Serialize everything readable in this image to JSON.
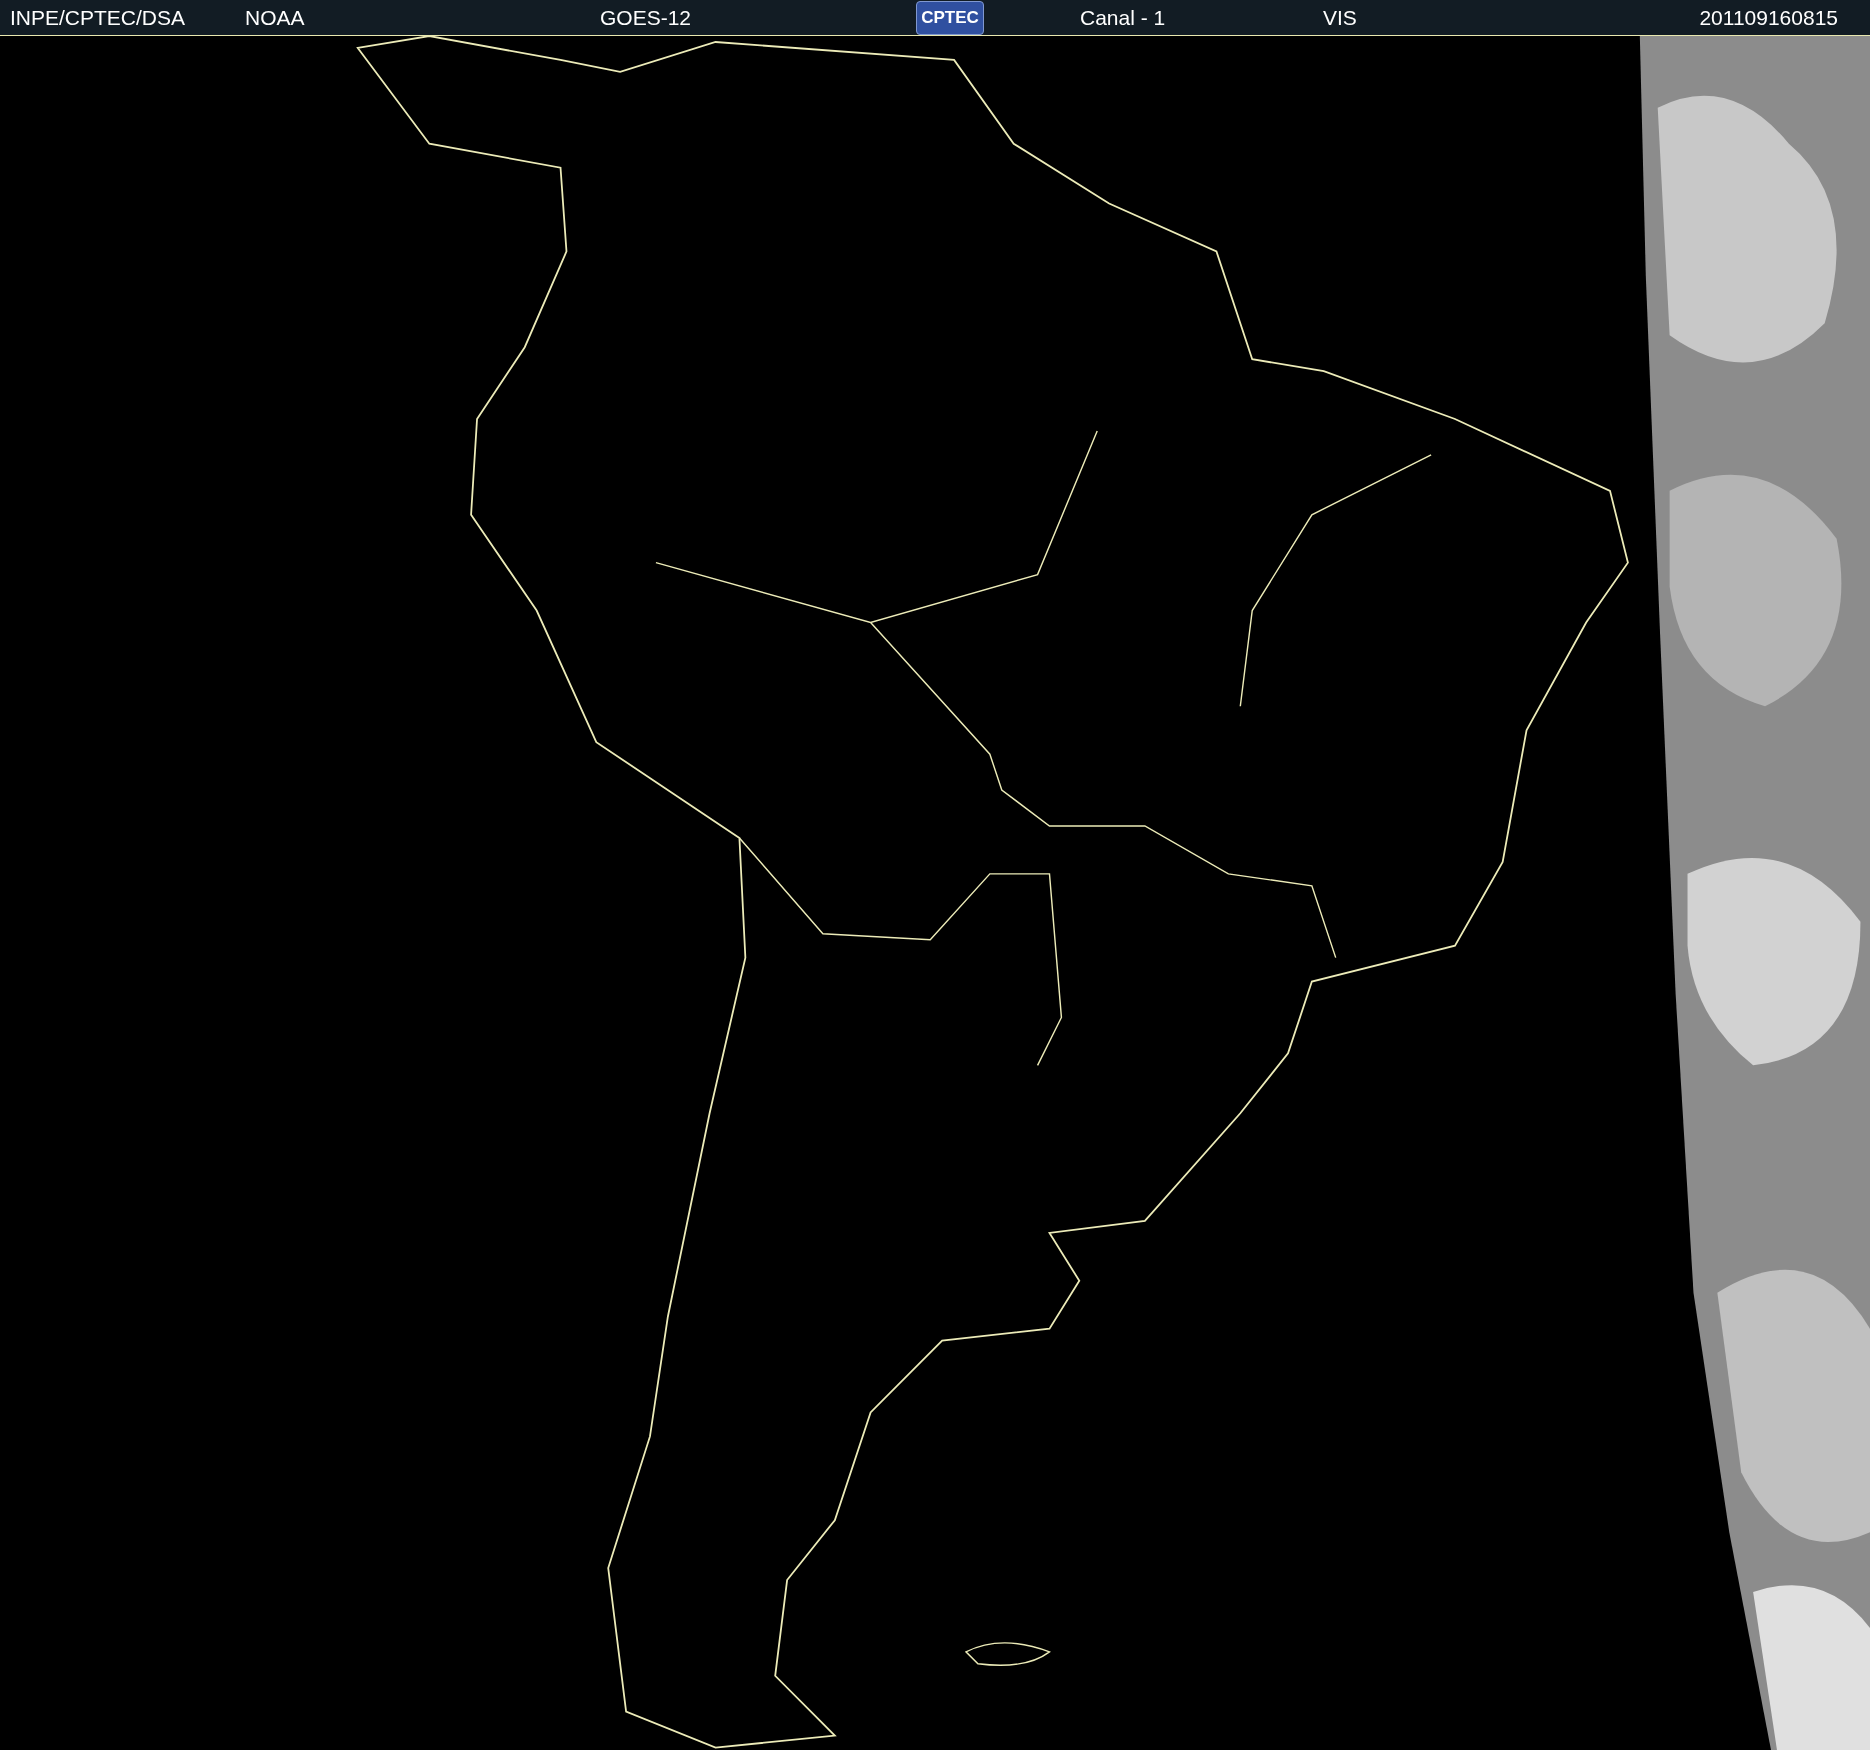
{
  "header": {
    "source": "INPE/CPTEC/DSA",
    "agency": "NOAA",
    "satellite": "GOES-12",
    "logo": "CPTEC",
    "channel": "Canal - 1",
    "band": "VIS",
    "timestamp": "201109160815"
  }
}
